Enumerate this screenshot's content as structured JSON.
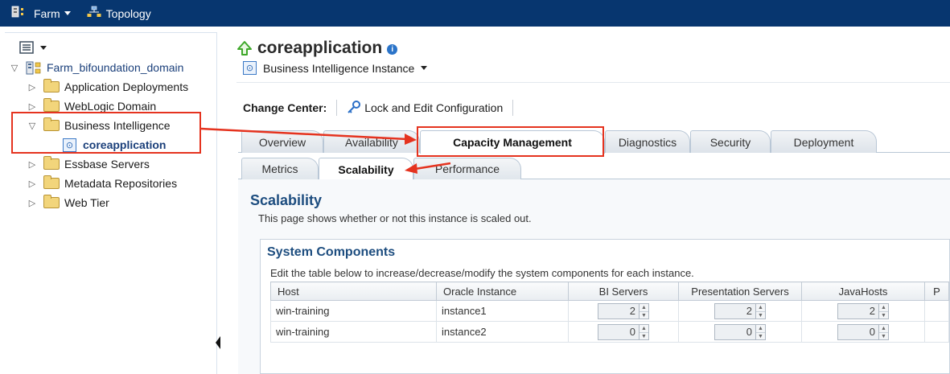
{
  "topbar": {
    "farm_label": "Farm",
    "topology_label": "Topology"
  },
  "tree": {
    "root": "Farm_bifoundation_domain",
    "items": [
      {
        "label": "Application Deployments",
        "state": "collapsed"
      },
      {
        "label": "WebLogic Domain",
        "state": "collapsed"
      },
      {
        "label": "Business Intelligence",
        "state": "expanded"
      },
      {
        "label": "Essbase Servers",
        "state": "collapsed"
      },
      {
        "label": "Metadata Repositories",
        "state": "collapsed"
      },
      {
        "label": "Web Tier",
        "state": "collapsed"
      }
    ],
    "selected_child": "coreapplication"
  },
  "page": {
    "title": "coreapplication",
    "subtitle": "Business Intelligence Instance"
  },
  "change_center": {
    "label": "Change Center:",
    "lock_link": "Lock and Edit Configuration"
  },
  "tabs": [
    "Overview",
    "Availability",
    "Capacity Management",
    "Diagnostics",
    "Security",
    "Deployment"
  ],
  "active_tab": "Capacity Management",
  "subtabs": [
    "Metrics",
    "Scalability",
    "Performance"
  ],
  "active_subtab": "Scalability",
  "scalability": {
    "title": "Scalability",
    "description": "This page shows whether or not this instance is scaled out."
  },
  "system_components": {
    "title": "System Components",
    "description": "Edit the table below to increase/decrease/modify the system components for each instance.",
    "columns": [
      "Host",
      "Oracle Instance",
      "BI Servers",
      "Presentation Servers",
      "JavaHosts",
      "P"
    ],
    "rows": [
      {
        "host": "win-training",
        "instance": "instance1",
        "bi_servers": "2",
        "presentation_servers": "2",
        "javahosts": "2"
      },
      {
        "host": "win-training",
        "instance": "instance2",
        "bi_servers": "0",
        "presentation_servers": "0",
        "javahosts": "0"
      }
    ]
  },
  "colors": {
    "topbar": "#07366f",
    "highlight": "#e5331f",
    "title_blue": "#1d4d7f"
  }
}
